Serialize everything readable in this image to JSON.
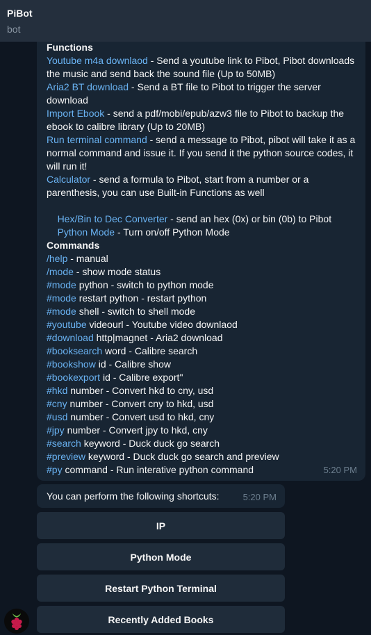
{
  "header": {
    "title": "PiBot",
    "subtitle": "bot"
  },
  "message": {
    "functions_heading": "Functions",
    "functions": [
      {
        "link": "Youtube m4a downlaod",
        "text": " - Send a youtube link to Pibot, Pibot downloads the music and send back the sound file (Up to 50MB)"
      },
      {
        "link": "Aria2 BT download",
        "text": " - Send a BT file to Pibot to trigger the server download"
      },
      {
        "link": "Import Ebook",
        "text": " - send a pdf/mobi/epub/azw3 file to Pibot to backup the ebook to calibre library (Up to 20MB)"
      },
      {
        "link": "Run terminal command",
        "text": " - send a message to Pibot, pibot will take it as a normal command and issue it. If you send it the python source codes, it will run it!"
      },
      {
        "link": "Calculator",
        "text": " - send a formula to Pibot, start from a number or a parenthesis, you can use Built-in Functions as well"
      },
      {
        "link": "Hex/Bin to Dec Converter",
        "text": " - send an hex (0x) or bin (0b) to Pibot"
      },
      {
        "link": "Python Mode",
        "text": " - Turn on/off Python Mode"
      }
    ],
    "commands_heading": "Commands",
    "commands": [
      {
        "cmd": "/help",
        "text": " - manual"
      },
      {
        "cmd": "/mode",
        "text": " - show mode status"
      },
      {
        "cmd": "#mode",
        "text": " python - switch to python mode"
      },
      {
        "cmd": "#mode",
        "text": " restart python - restart python"
      },
      {
        "cmd": "#mode",
        "text": " shell - switch to shell mode"
      },
      {
        "cmd": "#youtube",
        "text": " videourl - Youtube video downlaod"
      },
      {
        "cmd": "#download",
        "text": " http|magnet - Aria2 download"
      },
      {
        "cmd": "#booksearch",
        "text": " word - Calibre search"
      },
      {
        "cmd": "#bookshow",
        "text": " id - Calibre show"
      },
      {
        "cmd": "#bookexport",
        "text": " id - Calibre export\""
      },
      {
        "cmd": "#hkd",
        "text": " number - Convert hkd to cny, usd"
      },
      {
        "cmd": "#cny",
        "text": " number - Convert cny to hkd, usd"
      },
      {
        "cmd": "#usd",
        "text": " number - Convert usd to hkd, cny"
      },
      {
        "cmd": "#jpy",
        "text": " number - Convert jpy to hkd, cny"
      },
      {
        "cmd": "#search",
        "text": " keyword - Duck duck go search"
      },
      {
        "cmd": "#preview",
        "text": " keyword - Duck duck go search and preview"
      },
      {
        "cmd": "#py",
        "text": " command - Run interative python command"
      }
    ],
    "time": "5:20 PM"
  },
  "shortcuts": {
    "text": "You can perform the following shortcuts:",
    "time": "5:20 PM"
  },
  "keyboard": [
    "IP",
    "Python Mode",
    "Restart Python Terminal",
    "Recently Added Books"
  ],
  "colors": {
    "link": "#6ab3f3",
    "bubble": "#182533",
    "background": "#0e1621",
    "header": "#242f3d"
  },
  "icons": {
    "avatar": "raspberry-pi-icon"
  }
}
